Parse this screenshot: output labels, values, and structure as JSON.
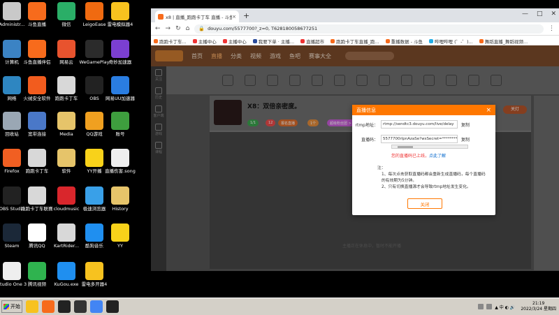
{
  "desktop": {
    "icons": [
      {
        "label": "Administr...",
        "color": "#c9c9c9"
      },
      {
        "label": "斗鱼直播",
        "color": "#f76b1c"
      },
      {
        "label": "微信",
        "color": "#2aae67"
      },
      {
        "label": "LeigoEase",
        "color": "#f06a10"
      },
      {
        "label": "雷电模拟器4",
        "color": "#f7c21f"
      },
      {
        "label": "计算机",
        "color": "#3b83c4"
      },
      {
        "label": "斗鱼直播伴侣",
        "color": "#f76b1c"
      },
      {
        "label": "网易云",
        "color": "#e8532e"
      },
      {
        "label": "WeGamePlay",
        "color": "#2b2b2b"
      },
      {
        "label": "奇妙加速器",
        "color": "#7b3fd1"
      },
      {
        "label": "网络",
        "color": "#2e86c1"
      },
      {
        "label": "火绒安全软件",
        "color": "#f25c1e"
      },
      {
        "label": "跑跑卡丁车",
        "color": "#d8d8d8"
      },
      {
        "label": "OBS",
        "color": "#222222"
      },
      {
        "label": "网易UU加速器",
        "color": "#2a7de1"
      },
      {
        "label": "回收站",
        "color": "#9aa7b4"
      },
      {
        "label": "宽带连接",
        "color": "#4a78c8"
      },
      {
        "label": "Media",
        "color": "#e6c46a"
      },
      {
        "label": "QQ游戏",
        "color": "#f0a020"
      },
      {
        "label": "账号",
        "color": "#3e9e3e"
      },
      {
        "label": "Firefox",
        "color": "#f15f22"
      },
      {
        "label": "跑跑卡丁车",
        "color": "#d8d8d8"
      },
      {
        "label": "软件",
        "color": "#e6c46a"
      },
      {
        "label": "YY开播",
        "color": "#f8d21a"
      },
      {
        "label": "直播伤害.song",
        "color": "#eeeeee"
      },
      {
        "label": "OBS Studio",
        "color": "#222222"
      },
      {
        "label": "跑跑卡丁车联赛服",
        "color": "#d8d8d8"
      },
      {
        "label": "cloudmusic",
        "color": "#d9262c"
      },
      {
        "label": "极速浏览器",
        "color": "#39a0e8"
      },
      {
        "label": "History",
        "color": "#e6c46a"
      },
      {
        "label": "Steam",
        "color": "#1b2838"
      },
      {
        "label": "腾讯QQ",
        "color": "#ffffff"
      },
      {
        "label": "KartRider...",
        "color": "#d8d8d8"
      },
      {
        "label": "酷狗音乐",
        "color": "#1f8ff0"
      },
      {
        "label": "YY",
        "color": "#f8d21a"
      },
      {
        "label": "Studio One 3",
        "color": "#eeeeee"
      },
      {
        "label": "腾讯视频",
        "color": "#2fb34f"
      },
      {
        "label": "KuGou.exe",
        "color": "#1f8ff0"
      },
      {
        "label": "雷电多开器4",
        "color": "#f7c21f"
      }
    ]
  },
  "browser": {
    "tab_title": "x8 | 直播_跑跑卡丁车 直播 - 斗鱼",
    "tab_close": "×",
    "new_tab": "+",
    "url": "douyu.com/5577700?_z=0, T628180058677251",
    "bookmarks": [
      {
        "label": "跑跑卡丁车...",
        "color": "#f76b1c"
      },
      {
        "label": "主播中心",
        "color": "#e33"
      },
      {
        "label": "主播中心",
        "color": "#e33"
      },
      {
        "label": "我要下单 · 主播...",
        "color": "#2a4b9b"
      },
      {
        "label": "直播超市",
        "color": "#e33"
      },
      {
        "label": "跑跑卡丁车直播_跑...",
        "color": "#f76b1c"
      },
      {
        "label": "重播数据 - 斗鱼",
        "color": "#f76b1c"
      },
      {
        "label": "哔哩哔哩 (゜-゜)...",
        "color": "#23ade5"
      },
      {
        "label": "舞蹈直播_舞蹈视频...",
        "color": "#f76b1c"
      }
    ]
  },
  "site": {
    "nav": [
      "首页",
      "直播",
      "分类",
      "视频",
      "游戏",
      "鱼吧",
      "赛事大全"
    ],
    "sidebar": [
      "关注",
      "历史",
      "客户端",
      "游戏",
      "课程"
    ],
    "room_title": "X8：双倍亲密度。",
    "tags": [
      {
        "label": "1/1",
        "color": "#3aa14c"
      },
      {
        "label": "12",
        "color": "#e94a4a"
      },
      {
        "label": "报名直播",
        "color": "#d86a2a"
      },
      {
        "label": "1个",
        "color": "#e08a3a"
      },
      {
        "label": "超级粉丝团 >",
        "color": "#c65bd6"
      }
    ],
    "light_button": "关灯",
    "video_msg": "主播正在休息中，暂时不能开播"
  },
  "modal": {
    "title": "直播信息",
    "close": "×",
    "rtmp_label": "rtmp地址：",
    "rtmp_value": "rtmp://sendtc3.douyu.com/live/delay",
    "key_label": "直播码：",
    "key_value": "5577700rlpnAzaSe?wsSecret=**********",
    "copy": "复制",
    "warning": "您的直播码已上线，",
    "warning_link": "点此了解",
    "notes_title": "注：",
    "notes": [
      "1、每次点击获取直播码都会重新生成直播码，每个直播码的有效期为5分钟。",
      "2、只有切换直播源才会导致rtmp地址发生变化。"
    ],
    "close_button": "关闭"
  },
  "taskbar": {
    "start": "开始",
    "apps": [
      {
        "color": "#f7c21f"
      },
      {
        "color": "#f76b1c"
      },
      {
        "color": "#222222"
      },
      {
        "color": "#333333"
      },
      {
        "color": "#4285f4"
      },
      {
        "color": "#222222"
      }
    ],
    "tray_text": "▲ 中 ◐ 🔊",
    "time": "21:19",
    "date": "2022/3/24 星期四"
  },
  "colors": {
    "accent": "#ff7700",
    "brand": "#f76b1c"
  }
}
